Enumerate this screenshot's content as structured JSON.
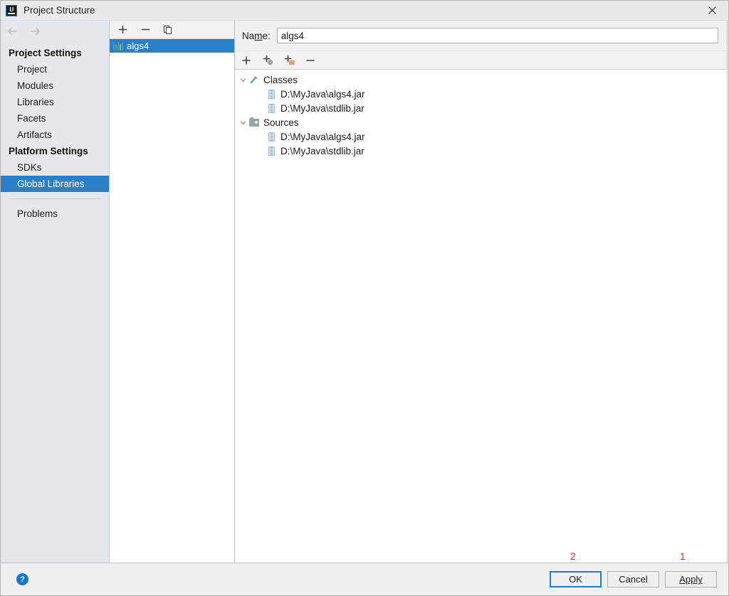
{
  "window": {
    "title": "Project Structure",
    "app_icon": "intellij-idea-icon",
    "close_label": "×"
  },
  "nav": {
    "back_icon": "arrow-left-icon",
    "forward_icon": "arrow-right-icon"
  },
  "sidebar": {
    "groups": [
      {
        "label": "Project Settings",
        "items": [
          {
            "label": "Project",
            "selected": false
          },
          {
            "label": "Modules",
            "selected": false
          },
          {
            "label": "Libraries",
            "selected": false
          },
          {
            "label": "Facets",
            "selected": false
          },
          {
            "label": "Artifacts",
            "selected": false
          }
        ]
      },
      {
        "label": "Platform Settings",
        "items": [
          {
            "label": "SDKs",
            "selected": false
          },
          {
            "label": "Global Libraries",
            "selected": true
          }
        ]
      }
    ],
    "footer_items": [
      {
        "label": "Problems",
        "selected": false
      }
    ]
  },
  "library_panel": {
    "toolbar": [
      {
        "name": "add-library-button",
        "glyph": "+"
      },
      {
        "name": "remove-library-button",
        "glyph": "−"
      },
      {
        "name": "copy-library-button",
        "glyph": "copy-icon"
      }
    ],
    "items": [
      {
        "label": "algs4",
        "icon": "library-icon",
        "selected": true
      }
    ]
  },
  "details": {
    "name_field": {
      "label_prefix": "Na",
      "label_mnemonic": "m",
      "label_suffix": "e:",
      "value": "algs4",
      "placeholder": ""
    },
    "toolbar": [
      {
        "name": "add-root-button",
        "glyph": "+"
      },
      {
        "name": "add-url-root-button",
        "glyph": "+globe"
      },
      {
        "name": "add-directory-root-button",
        "glyph": "+folder"
      },
      {
        "name": "remove-root-button",
        "glyph": "−"
      }
    ],
    "tree": [
      {
        "label": "Classes",
        "icon": "classes-icon",
        "expanded": true,
        "twisty": "chevron-down-icon",
        "children": [
          {
            "label": "D:\\MyJava\\algs4.jar",
            "icon": "jar-icon"
          },
          {
            "label": "D:\\MyJava\\stdlib.jar",
            "icon": "jar-icon"
          }
        ]
      },
      {
        "label": "Sources",
        "icon": "sources-folder-icon",
        "expanded": true,
        "twisty": "chevron-down-icon",
        "children": [
          {
            "label": "D:\\MyJava\\algs4.jar",
            "icon": "jar-icon"
          },
          {
            "label": "D:\\MyJava\\stdlib.jar",
            "icon": "jar-icon"
          }
        ]
      }
    ]
  },
  "footer": {
    "help_label": "?",
    "buttons": [
      {
        "name": "ok-button",
        "label": "OK",
        "default": true
      },
      {
        "name": "cancel-button",
        "label": "Cancel",
        "default": false
      },
      {
        "name": "apply-button",
        "label": "Apply",
        "mnemonic": "A",
        "default": false
      }
    ]
  },
  "annotations": [
    {
      "label": "2",
      "target": "ok-button",
      "color": "#e8251f"
    },
    {
      "label": "1",
      "target": "apply-button",
      "color": "#e8251f"
    }
  ]
}
